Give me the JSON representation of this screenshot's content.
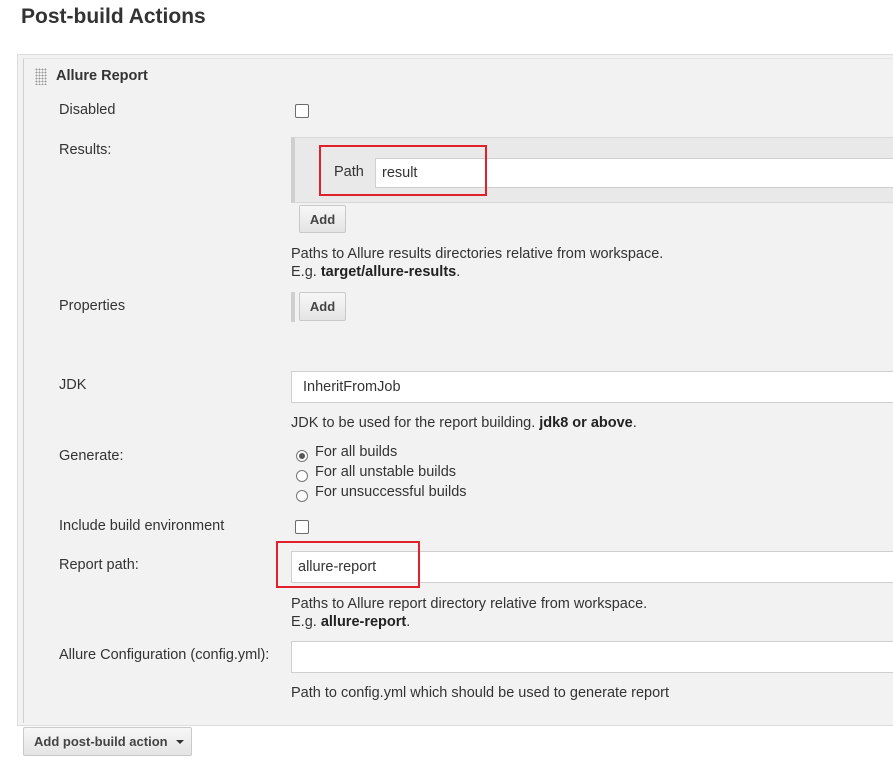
{
  "section_title": "Post-build Actions",
  "block_title": "Allure Report",
  "fields": {
    "disabled": {
      "label": "Disabled",
      "checked": false
    },
    "results": {
      "label": "Results:",
      "path_label": "Path",
      "path_value": "result",
      "add_label": "Add",
      "help_line1": "Paths to Allure results directories relative from workspace.",
      "help_prefix": "E.g. ",
      "help_bold": "target/allure-results",
      "help_suffix": "."
    },
    "properties": {
      "label": "Properties",
      "add_label": "Add"
    },
    "jdk": {
      "label": "JDK",
      "value": "InheritFromJob",
      "help_prefix": "JDK to be used for the report building. ",
      "help_bold": "jdk8 or above",
      "help_suffix": "."
    },
    "generate": {
      "label": "Generate:",
      "options": [
        "For all builds",
        "For all unstable builds",
        "For unsuccessful builds"
      ],
      "selected_index": 0
    },
    "include_build_env": {
      "label": "Include build environment",
      "checked": false
    },
    "report_path": {
      "label": "Report path:",
      "value": "allure-report",
      "help_line1": "Paths to Allure report directory relative from workspace.",
      "help_prefix": "E.g. ",
      "help_bold": "allure-report",
      "help_suffix": "."
    },
    "allure_config": {
      "label": "Allure Configuration (config.yml):",
      "value": "",
      "help": "Path to config.yml which should be used to generate report"
    }
  },
  "add_post_build_action_label": "Add post-build action",
  "colors": {
    "highlight_box": "#e0202a",
    "panel_bg": "#f2f2f2"
  }
}
